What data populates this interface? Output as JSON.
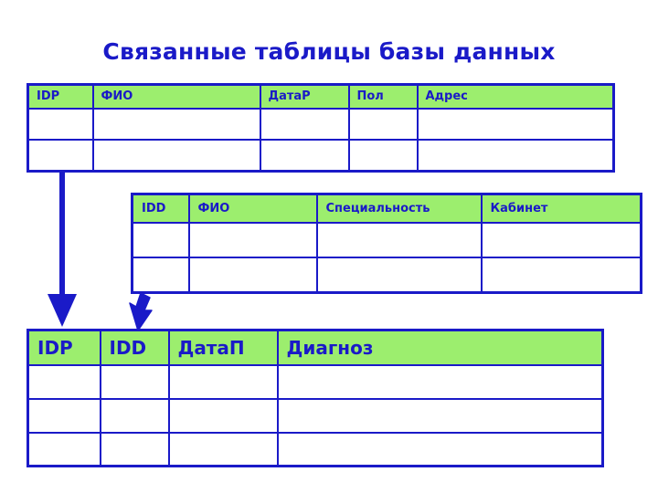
{
  "slide": {
    "title": "Связанные таблицы базы данных",
    "title_color": "#1a1ac8",
    "header_fill": "#9cee6e",
    "border_color": "#1a1ac8",
    "background": "#ffffff"
  },
  "tables": [
    {
      "name": "patients",
      "columns": [
        "IDP",
        "ФИО",
        "ДатаР",
        "Пол",
        "Адрес"
      ],
      "rows": [
        [
          "",
          "",
          "",
          "",
          ""
        ],
        [
          "",
          "",
          "",
          "",
          ""
        ]
      ]
    },
    {
      "name": "doctors",
      "columns": [
        "IDD",
        "ФИО",
        "Специальность",
        "Кабинет"
      ],
      "rows": [
        [
          "",
          "",
          "",
          ""
        ],
        [
          "",
          "",
          "",
          ""
        ]
      ]
    },
    {
      "name": "appointments",
      "columns": [
        "IDP",
        "IDD",
        "ДатаП",
        "Диагноз"
      ],
      "rows": [
        [
          "",
          "",
          "",
          ""
        ],
        [
          "",
          "",
          "",
          ""
        ],
        [
          "",
          "",
          "",
          ""
        ]
      ]
    }
  ],
  "connectors": [
    {
      "name": "patients-to-appointments",
      "from": "patients.IDP",
      "to": "appointments.IDP",
      "color": "#1a1ac8"
    },
    {
      "name": "doctors-to-appointments",
      "from": "doctors.IDD",
      "to": "appointments.IDD",
      "color": "#1a1ac8"
    }
  ]
}
